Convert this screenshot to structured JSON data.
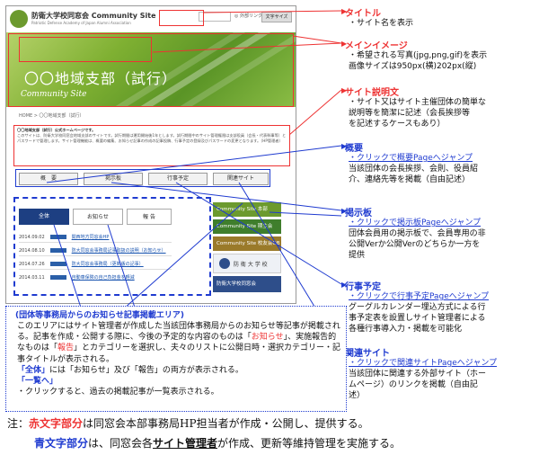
{
  "mock": {
    "site_name": "防衛大学校同窓会 Community Site",
    "site_sub": "Patriotic Defense Academy of Japan Alumni Association",
    "header_link": "◎ 外部リンク",
    "header_button": "文字サイズ",
    "hero_title": "〇〇地域支部（試行）",
    "hero_sub": "Community Site",
    "breadcrumb": "HOME  >  〇〇地域支部（試行）",
    "desc_title": "〇〇地域支部（試行）公式ホームページです。",
    "desc_body": "このサイトは、防衛大学校同窓会地域支部のサイトです。試行期間は運用開始後1年とします。試行期間中のサイト管理権限は支部役員（会長・代表幹事等）とパスワードで管理します。サイト管理機能は、概要の編集、お知らせ記事の作成の記事投稿、行事予定の登録及びパスワードの変更となります。（HP管理者）",
    "nav": [
      "概　要",
      "掲示板",
      "行事予定",
      "関連サイト"
    ],
    "notice_tabs": [
      "全体",
      "お知らせ",
      "報 告"
    ],
    "notice_rows": [
      {
        "date": "2014.09.02",
        "text": "関西地方同窓会HP"
      },
      {
        "date": "2014.08.10",
        "text": "防大同窓会事務局記事取扱の説明（お知らせ）"
      },
      {
        "date": "2014.07.26",
        "text": "防大同窓会事務局（更新版の記事）"
      },
      {
        "date": "2014.03.11",
        "text": "自動車保険の自己負担金を軽減"
      }
    ],
    "tiny_button": "一覧へ",
    "banners": [
      {
        "label": "Community Site  本部",
        "color": "#6c9a2e"
      },
      {
        "label": "Community Site  期生会",
        "color": "#3f7e2c"
      },
      {
        "label": "Community Site  校友会OB",
        "color": "#9a7a2a"
      }
    ],
    "emblem": "防 衛 大 学 校",
    "bottom_banner": "防衛大学校同窓会"
  },
  "annotations": [
    {
      "title": "タイトル",
      "color": "red",
      "lines": [
        "・サイト名を表示"
      ]
    },
    {
      "title": "メインイメージ",
      "color": "red",
      "lines": [
        "・希望される写真(jpg,png,gif)を表示",
        "画像サイズは950px(横)202px(縦)"
      ]
    },
    {
      "title": "サイト説明文",
      "color": "red",
      "lines": [
        "・サイト又はサイト主催団体の簡単な",
        "説明等を簡潔に記述（会長挨拶等",
        "を記述するケースもあり）"
      ]
    },
    {
      "title": "概要",
      "color": "blue",
      "lines": [
        "・クリックで概要Pageへジャンプ",
        "当該団体の会長挨拶、会則、役員紹",
        "介、連絡先等を掲載（自由記述）"
      ]
    },
    {
      "title": "掲示板",
      "color": "blue",
      "lines": [
        "・クリックで掲示板Pageへジャンプ",
        "団体会員用の掲示板で、会員専用の非",
        "公開Verか公開Verのどちらか一方を",
        "提供"
      ]
    },
    {
      "title": "行事予定",
      "color": "blue",
      "lines": [
        "・クリックで行事予定Pageへジャンプ",
        "グーグルカレンダー埋込方式による行",
        "事予定表を設置しサイト管理者による",
        "各種行事導入力・掲載を可能化"
      ]
    },
    {
      "title": "関連サイト",
      "color": "blue",
      "lines": [
        "・クリックで関連サイトPageへジャンプ",
        "当該団体に関連する外部サイト（ホー",
        "ムページ）のリンクを掲載（自由記",
        "述）"
      ]
    }
  ],
  "info_box": {
    "heading": "(団体等事務局からのお知らせ記事掲載エリア)",
    "p1": "このエリアにはサイト管理者が作成した当該団体事務局からのお知らせ等記事が掲載される。記事を作成・公開する際に、今後の予定的な内容のものは「",
    "q1": "お知らせ",
    "p2": "」、実施報告的なものは「",
    "q2": "報告",
    "p3": "」とカテゴリーを選択し、夫々のリストに公開日時・選択カテゴリー・記事タイトルが表示される。",
    "all_tab": "「全体」",
    "p4": "には「お知らせ」及び「報告」の両方が表示される。",
    "list_label": "「一覧へ」",
    "p5": "・クリックすると、過去の掲載記事が一覧表示される。"
  },
  "footer": {
    "n1_prefix": "注：",
    "n1_red": "赤文字部分",
    "n1_rest": "は同窓会本部事務局HP担当者が作成・公開し、提供する。",
    "n2_blue": "青文字部分",
    "n2_mid": "は、同窓会各",
    "n2_ul": "サイト管理者",
    "n2_rest": "が作成、更新等維持管理を実施する。"
  },
  "colors": {
    "red": "#ee3333",
    "blue": "#1f3bd0",
    "hero_green": "#7fb032"
  }
}
